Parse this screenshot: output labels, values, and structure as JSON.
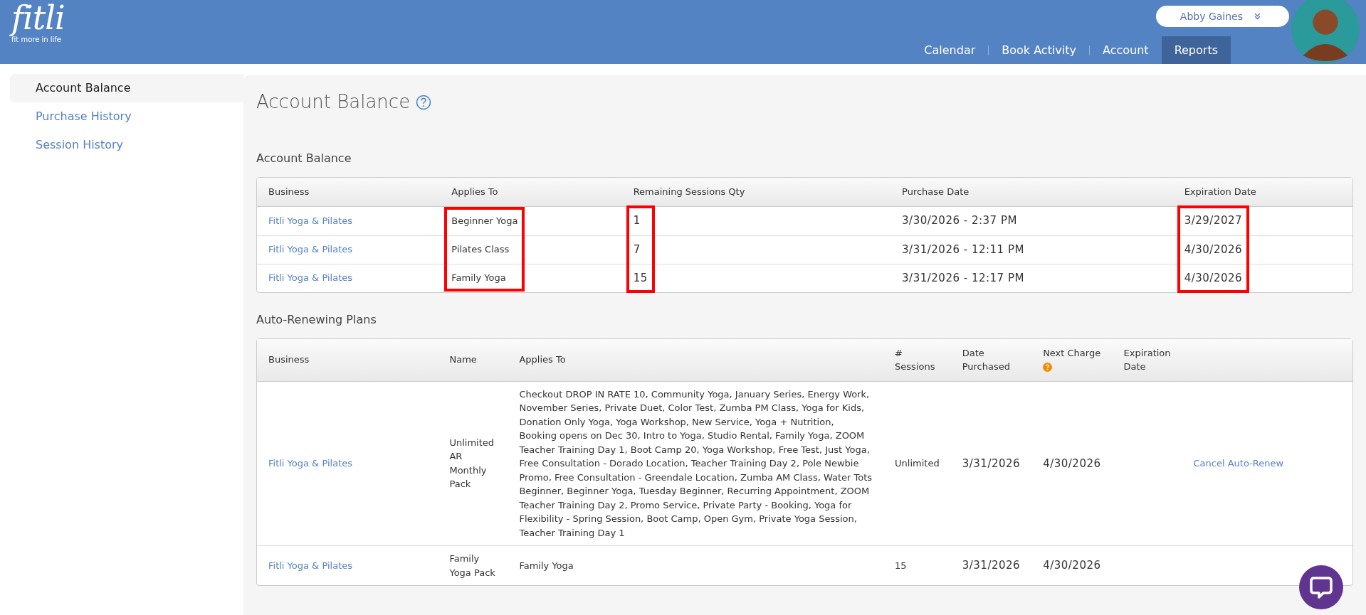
{
  "header": {
    "logo": "fitli",
    "tagline": "fit more in life",
    "user": "Abby Gaines",
    "nav": [
      {
        "label": "Calendar",
        "selected": false
      },
      {
        "label": "Book Activity",
        "selected": false
      },
      {
        "label": "Account",
        "selected": false
      },
      {
        "label": "Reports",
        "selected": true
      }
    ]
  },
  "sidebar": {
    "items": [
      {
        "label": "Account Balance",
        "selected": true
      },
      {
        "label": "Purchase History",
        "selected": false
      },
      {
        "label": "Session History",
        "selected": false
      }
    ]
  },
  "page_title": "Account Balance",
  "account_balance": {
    "title": "Account Balance",
    "columns": [
      {
        "label": "Business",
        "kind": "link",
        "highlighted": false
      },
      {
        "label": "Applies To",
        "kind": "text",
        "highlighted": true
      },
      {
        "label": "Remaining Sessions Qty",
        "kind": "number",
        "highlighted": true
      },
      {
        "label": "Purchase Date",
        "kind": "number",
        "highlighted": false
      },
      {
        "label": "Expiration Date",
        "kind": "number",
        "highlighted": true
      }
    ],
    "rows": [
      [
        "Fitli Yoga & Pilates",
        "Beginner Yoga",
        "1",
        "3/30/2026 - 2:37 PM",
        "3/29/2027"
      ],
      [
        "Fitli Yoga & Pilates",
        "Pilates Class",
        "7",
        "3/31/2026 - 12:11 PM",
        "4/30/2026"
      ],
      [
        "Fitli Yoga & Pilates",
        "Family Yoga",
        "15",
        "3/31/2026 - 12:17 PM",
        "4/30/2026"
      ]
    ]
  },
  "auto_renewing_plans": {
    "title": "Auto-Renewing Plans",
    "columns": [
      {
        "label": "Business",
        "kind": "link",
        "help": false
      },
      {
        "label": "Name",
        "kind": "text",
        "help": false
      },
      {
        "label": "Applies To",
        "kind": "text",
        "help": false
      },
      {
        "label": "# Sessions",
        "kind": "text",
        "help": false
      },
      {
        "label": "Date Purchased",
        "kind": "number",
        "help": false
      },
      {
        "label": "Next Charge",
        "kind": "number",
        "help": true
      },
      {
        "label": "Expiration Date",
        "kind": "number",
        "help": false
      },
      {
        "kind": "link",
        "help": false
      }
    ],
    "rows": [
      [
        "Fitli Yoga & Pilates",
        "Unlimited AR Monthly Pack",
        "Checkout DROP IN RATE 10, Community Yoga, January Series, Energy Work, November Series, Private Duet, Color Test, Zumba PM Class, Yoga for Kids, Donation Only Yoga, Yoga Workshop, New Service, Yoga + Nutrition, Booking opens on Dec 30, Intro to Yoga, Studio Rental, Family Yoga, ZOOM Teacher Training Day 1, Boot Camp 20, Yoga Workshop, Free Test, Just Yoga, Free Consultation - Dorado Location, Teacher Training Day 2, Pole Newbie Promo, Free Consultation - Greendale Location, Zumba AM Class, Water Tots Beginner, Beginner Yoga, Tuesday Beginner, Recurring Appointment, ZOOM Teacher Training Day 2, Promo Service, Private Party - Booking, Yoga for Flexibility - Spring Session, Boot Camp, Open Gym, Private Yoga Session, Teacher Training Day 1",
        "Unlimited",
        "3/31/2026",
        "4/30/2026",
        null,
        "Cancel Auto-Renew"
      ],
      [
        "Fitli Yoga & Pilates",
        "Family Yoga Pack",
        "Family Yoga",
        "15",
        "3/31/2026",
        "4/30/2026",
        null,
        null
      ]
    ]
  }
}
